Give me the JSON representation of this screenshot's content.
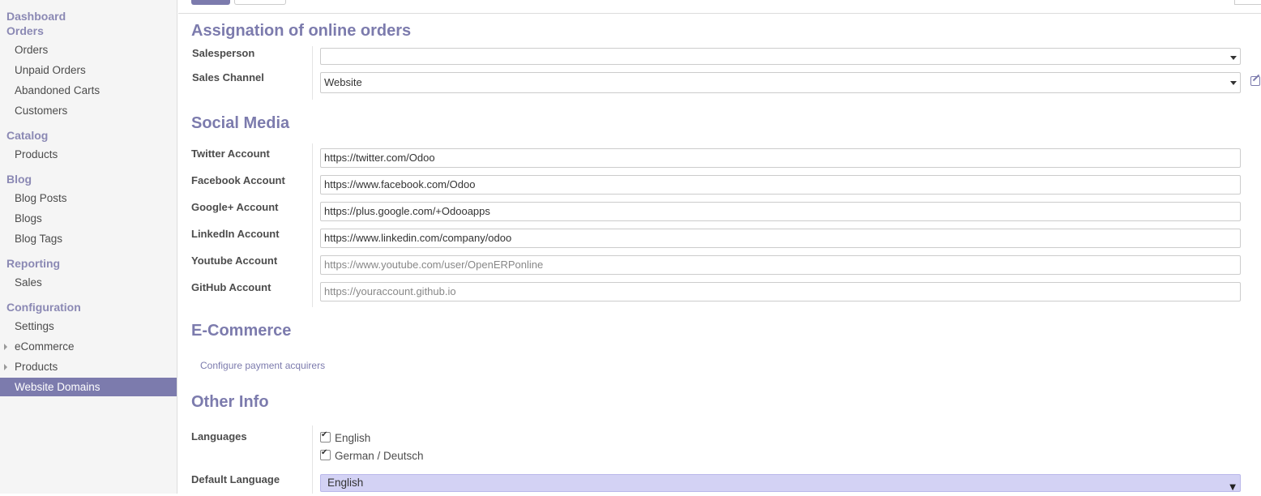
{
  "sidebar": {
    "dashboard": "Dashboard",
    "orders_head": "Orders",
    "orders_items": [
      "Orders",
      "Unpaid Orders",
      "Abandoned Carts",
      "Customers"
    ],
    "catalog_head": "Catalog",
    "catalog_items": [
      "Products"
    ],
    "blog_head": "Blog",
    "blog_items": [
      "Blog Posts",
      "Blogs",
      "Blog Tags"
    ],
    "reporting_head": "Reporting",
    "reporting_items": [
      "Sales"
    ],
    "config_head": "Configuration",
    "config_items": [
      "Settings",
      "eCommerce",
      "Products",
      "Website Domains"
    ],
    "active_item": "Website Domains"
  },
  "assignation": {
    "title": "Assignation of online orders",
    "salesperson_label": "Salesperson",
    "salesperson_value": "",
    "sales_channel_label": "Sales Channel",
    "sales_channel_value": "Website"
  },
  "social": {
    "title": "Social Media",
    "fields": [
      {
        "label": "Twitter Account",
        "value": "https://twitter.com/Odoo",
        "placeholder": ""
      },
      {
        "label": "Facebook Account",
        "value": "https://www.facebook.com/Odoo",
        "placeholder": ""
      },
      {
        "label": "Google+ Account",
        "value": "https://plus.google.com/+Odooapps",
        "placeholder": ""
      },
      {
        "label": "LinkedIn Account",
        "value": "https://www.linkedin.com/company/odoo",
        "placeholder": ""
      },
      {
        "label": "Youtube Account",
        "value": "",
        "placeholder": "https://www.youtube.com/user/OpenERPonline"
      },
      {
        "label": "GitHub Account",
        "value": "",
        "placeholder": "https://youraccount.github.io"
      }
    ]
  },
  "ecommerce": {
    "title": "E-Commerce",
    "link": "Configure payment acquirers"
  },
  "other": {
    "title": "Other Info",
    "languages_label": "Languages",
    "languages": [
      {
        "name": "English",
        "checked": true
      },
      {
        "name": "German / Deutsch",
        "checked": true
      }
    ],
    "default_language_label": "Default Language",
    "default_language_value": "English"
  },
  "colors": {
    "accent": "#7c7bad",
    "selected_field": "#d3d2f4"
  }
}
